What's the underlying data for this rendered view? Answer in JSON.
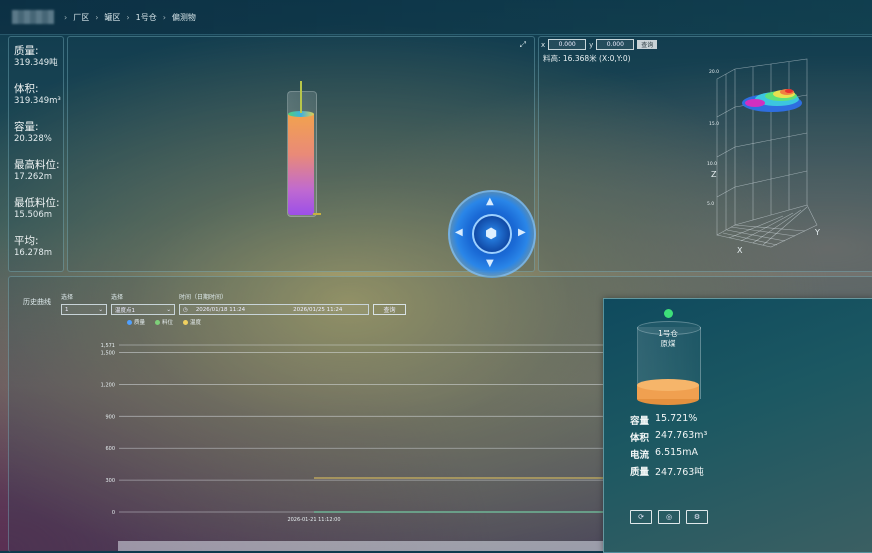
{
  "breadcrumb": {
    "items": [
      "厂区",
      "罐区",
      "1号仓",
      "偏测物"
    ]
  },
  "stats": [
    {
      "label": "质量:",
      "value": "319.349吨"
    },
    {
      "label": "体积:",
      "value": "319.349m³"
    },
    {
      "label": "容量:",
      "value": "20.328%"
    },
    {
      "label": "最高料位:",
      "value": "17.262m"
    },
    {
      "label": "最低料位:",
      "value": "15.506m"
    },
    {
      "label": "平均:",
      "value": "16.278m"
    }
  ],
  "silo_view": {
    "fill_fraction": 0.8
  },
  "view3d": {
    "x_label": "x",
    "x_value": "0.000",
    "y_label": "y",
    "y_value": "0.000",
    "button": "查询",
    "readout": "料高: 16.368米 (X:0,Y:0)",
    "axis_x": "X",
    "axis_y": "Y",
    "axis_z": "Z",
    "z_ticks": [
      "20.0",
      "15.0",
      "10.0",
      "5.0"
    ]
  },
  "history": {
    "title": "历史曲线",
    "select1_label": "选择",
    "select1_value": "1",
    "select2_label": "选择",
    "select2_value": "温度点1",
    "time_label": "时间（日期时间）",
    "start_time": "2026/01/18 11:24",
    "end_time": "2026/01/25 11:24",
    "query": "查询",
    "legend": [
      {
        "name": "质量",
        "color": "#4fa0ff"
      },
      {
        "name": "料位",
        "color": "#7ed07a"
      },
      {
        "name": "温度",
        "color": "#f0d060"
      }
    ]
  },
  "chart_data": {
    "type": "line",
    "y_ticks": [
      "1,571",
      "1,500",
      "1,200",
      "900",
      "600",
      "300",
      "0"
    ],
    "ylim": [
      0,
      1571
    ],
    "x_ticks": [
      "2026-01-21 11:12:00"
    ],
    "series": [
      {
        "name": "质量",
        "values": [
          0,
          0
        ]
      },
      {
        "name": "料位",
        "values": [
          0,
          0
        ]
      },
      {
        "name": "温度",
        "values": [
          320,
          320
        ]
      }
    ]
  },
  "card": {
    "name": "1号仓",
    "material": "原煤",
    "fill_fraction": 0.157,
    "rows": [
      {
        "k": "容量",
        "v": "15.721%"
      },
      {
        "k": "体积",
        "v": "247.763m³"
      },
      {
        "k": "电流",
        "v": "6.515mA"
      },
      {
        "k": "质量",
        "v": "247.763吨"
      }
    ],
    "buttons": [
      "⟳",
      "◎",
      "⚙"
    ]
  },
  "colors": {
    "online": "#3ee07a",
    "fill": "#f0a050"
  }
}
